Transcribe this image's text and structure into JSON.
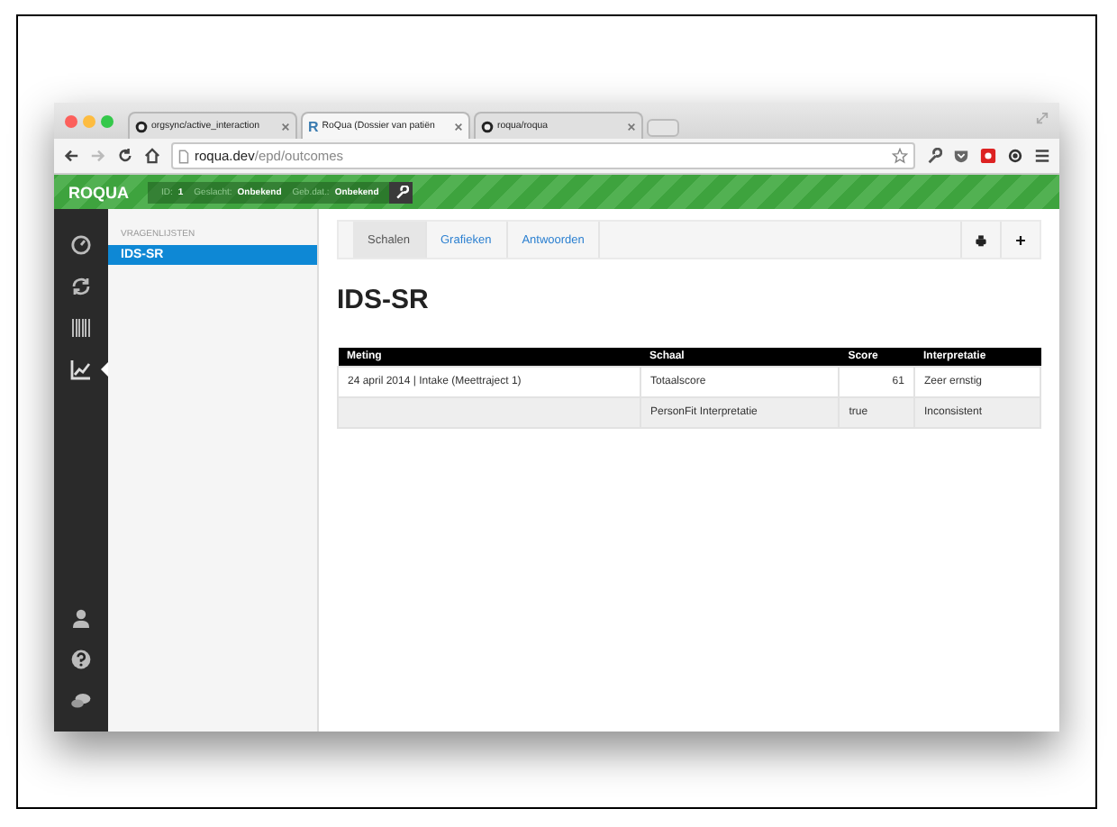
{
  "browser": {
    "tabs": [
      {
        "label": "orgsync/active_interaction",
        "selected": false
      },
      {
        "label": "RoQua (Dossier van patiën",
        "selected": true,
        "favicon_text": "R"
      },
      {
        "label": "roqua/roqua",
        "selected": false
      }
    ],
    "url_host": "roqua.dev",
    "url_path": "/epd/outcomes"
  },
  "header": {
    "logo": "ROQUA",
    "fields": [
      {
        "label": "ID:",
        "value": "1"
      },
      {
        "label": "Geslacht:",
        "value": "Onbekend"
      },
      {
        "label": "Geb.dat.:",
        "value": "Onbekend"
      }
    ]
  },
  "nav": {
    "items": [
      {
        "kind": "dashboard",
        "selected": false
      },
      {
        "kind": "refresh",
        "selected": false
      },
      {
        "kind": "barcode",
        "selected": false
      },
      {
        "kind": "chart",
        "selected": true
      }
    ],
    "bottom": [
      {
        "kind": "user"
      },
      {
        "kind": "help"
      },
      {
        "kind": "chat"
      }
    ]
  },
  "sidebar": {
    "heading": "VRAGENLIJSTEN",
    "items": [
      {
        "label": "IDS-SR",
        "selected": true
      }
    ]
  },
  "subnav": {
    "tabs": [
      {
        "label": "Schalen",
        "selected": true
      },
      {
        "label": "Grafieken",
        "selected": false
      },
      {
        "label": "Antwoorden",
        "selected": false
      }
    ]
  },
  "title": "IDS-SR",
  "table": {
    "columns": [
      "Meting",
      "Schaal",
      "Score",
      "Interpretatie"
    ],
    "rows": [
      [
        "24 april 2014 | Intake (Meettraject 1)",
        "Totaalscore",
        "61",
        "Zeer ernstig"
      ],
      [
        "",
        "PersonFit Interpretatie",
        "true",
        "Inconsistent"
      ]
    ]
  }
}
